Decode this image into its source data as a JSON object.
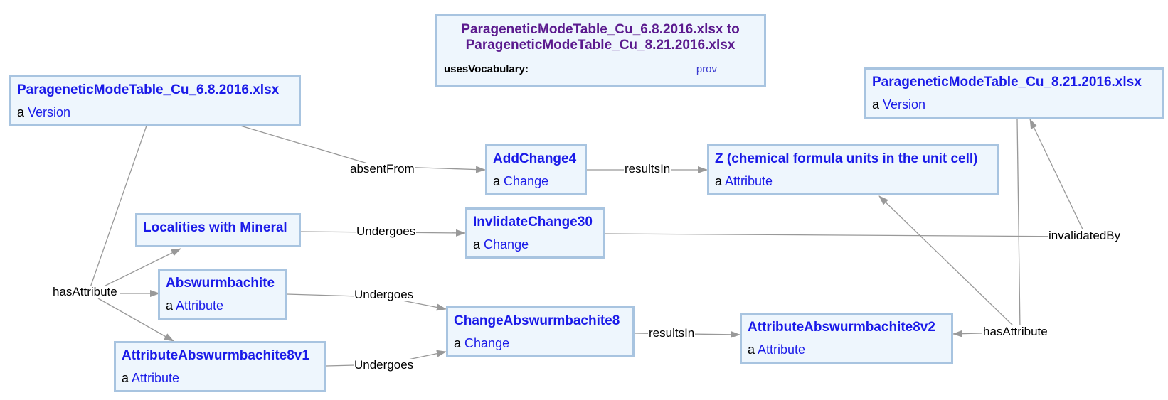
{
  "graph": {
    "title_line1": "ParageneticModeTable_Cu_6.8.2016.xlsx to",
    "title_line2": "ParageneticModeTable_Cu_8.21.2016.xlsx",
    "vocab_label": "usesVocabulary:",
    "vocab_value": "prov"
  },
  "type_prefix": "a",
  "nodes": {
    "v1": {
      "title": "ParageneticModeTable_Cu_6.8.2016.xlsx",
      "cls": "Version"
    },
    "v2": {
      "title": "ParageneticModeTable_Cu_8.21.2016.xlsx",
      "cls": "Version"
    },
    "add": {
      "title": "AddChange4",
      "cls": "Change"
    },
    "z": {
      "title": "Z (chemical formula units in the unit cell)",
      "cls": "Attribute"
    },
    "loc": {
      "title": "Localities with Mineral",
      "cls": ""
    },
    "inv": {
      "title": "InvlidateChange30",
      "cls": "Change"
    },
    "absw": {
      "title": "Abswurmbachite",
      "cls": "Attribute"
    },
    "chg": {
      "title": "ChangeAbswurmbachite8",
      "cls": "Change"
    },
    "a1": {
      "title": "AttributeAbswurmbachite8v1",
      "cls": "Attribute"
    },
    "a2": {
      "title": "AttributeAbswurmbachite8v2",
      "cls": "Attribute"
    }
  },
  "edge_labels": {
    "absentFrom": "absentFrom",
    "resultsIn1": "resultsIn",
    "undergoes1": "Undergoes",
    "invalidatedBy": "invalidatedBy",
    "hasAttribute1": "hasAttribute",
    "undergoes2": "Undergoes",
    "undergoes3": "Undergoes",
    "resultsIn2": "resultsIn",
    "hasAttribute2": "hasAttribute"
  },
  "colors": {
    "node_fill": "#eef6fd",
    "node_border": "#a8c4e0",
    "title": "#1a1ae8",
    "graph_title": "#5b1a8e",
    "edge": "#999999"
  }
}
